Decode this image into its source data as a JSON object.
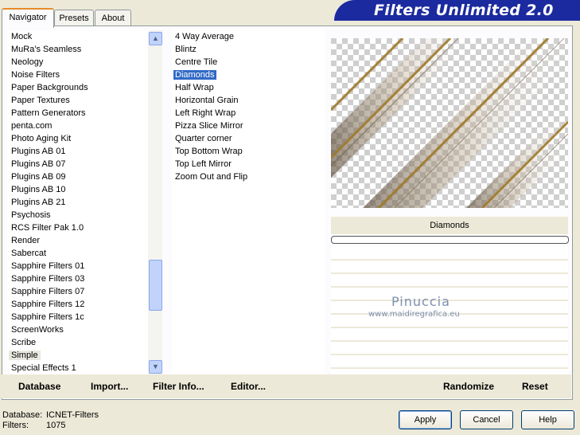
{
  "app": {
    "title": "Filters Unlimited 2.0"
  },
  "tabs": [
    {
      "label": "Navigator",
      "active": true
    },
    {
      "label": "Presets",
      "active": false
    },
    {
      "label": "About",
      "active": false
    }
  ],
  "categories": [
    "Mock",
    "MuRa's Seamless",
    "Neology",
    "Noise Filters",
    "Paper Backgrounds",
    "Paper Textures",
    "Pattern Generators",
    "penta.com",
    "Photo Aging Kit",
    "Plugins AB 01",
    "Plugins AB 07",
    "Plugins AB 09",
    "Plugins AB 10",
    "Plugins AB 21",
    "Psychosis",
    "RCS Filter Pak 1.0",
    "Render",
    "Sabercat",
    "Sapphire Filters 01",
    "Sapphire Filters 03",
    "Sapphire Filters 07",
    "Sapphire Filters 12",
    "Sapphire Filters 1c",
    "ScreenWorks",
    "Scribe",
    "Simple",
    "Special Effects 1"
  ],
  "selected_category": "Simple",
  "filters": [
    "4 Way Average",
    "Blintz",
    "Centre Tile",
    "Diamonds",
    "Half Wrap",
    "Horizontal Grain",
    "Left Right Wrap",
    "Pizza Slice Mirror",
    "Quarter corner",
    "Top Bottom Wrap",
    "Top Left Mirror",
    "Zoom Out and Flip"
  ],
  "selected_filter": "Diamonds",
  "preview": {
    "label": "Diamonds",
    "watermark_name": "Pinuccia",
    "watermark_url": "www.maidiregrafica.eu"
  },
  "buttons": {
    "database": "Database",
    "import": "Import...",
    "filter_info": "Filter Info...",
    "editor": "Editor...",
    "randomize": "Randomize",
    "reset": "Reset",
    "apply": "Apply",
    "cancel": "Cancel",
    "help": "Help"
  },
  "status": {
    "database_label": "Database:",
    "database_value": "ICNET-Filters",
    "filters_label": "Filters:",
    "filters_value": "1075"
  },
  "colors": {
    "title_banner": "#1b2a9e",
    "selection": "#316ac5",
    "window_bg": "#ece9d8"
  }
}
